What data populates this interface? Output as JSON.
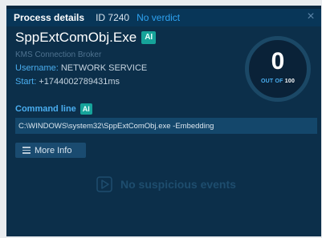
{
  "header": {
    "title": "Process details",
    "id_text": "ID 7240",
    "verdict": "No verdict",
    "close_label": "×"
  },
  "process": {
    "name": "SppExtComObj.Exe",
    "ai_badge": "AI",
    "description": "KMS Connection Broker",
    "username_key": "Username:",
    "username_value": "NETWORK SERVICE",
    "start_key": "Start:",
    "start_value": "+1744002789431ms"
  },
  "score": {
    "value": "0",
    "label_prefix": "OUT OF",
    "label_max": "100"
  },
  "command_line": {
    "title": "Command line",
    "ai_badge": "AI",
    "value": "C:\\WINDOWS\\system32\\SppExtComObj.exe -Embedding"
  },
  "buttons": {
    "more_info": "More Info"
  },
  "events": {
    "empty_text": "No suspicious events"
  },
  "colors": {
    "panel": "#0c2f4a",
    "header": "#083658",
    "accent": "#4aaef0",
    "ai_badge": "#16a39a"
  },
  "icons": [
    "close-icon",
    "menu-lines-icon",
    "play-outline-icon"
  ]
}
